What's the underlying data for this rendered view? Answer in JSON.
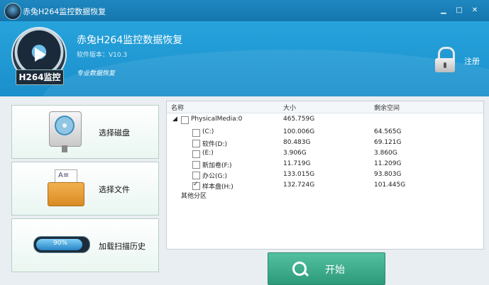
{
  "window": {
    "title": "赤兔H264监控数据恢复"
  },
  "header": {
    "logo_label": "H264监控",
    "app_name": "赤兔H264监控数据恢复",
    "version": "软件版本：V10.3",
    "slogan": "专业数据恢复",
    "register_label": "注册"
  },
  "left_panel": {
    "select_disk": "选择磁盘",
    "select_file": "选择文件",
    "load_history": "加载扫描历史",
    "history_progress_text": "90%",
    "history_progress_fraction": 0.9
  },
  "table": {
    "columns": [
      "名称",
      "大小",
      "剩余空间"
    ],
    "root": {
      "name": "PhysicalMedia:0",
      "size": "465.759G",
      "checked": false
    },
    "rows": [
      {
        "name": "(C:)",
        "size": "100.006G",
        "free": "64.565G",
        "checked": false
      },
      {
        "name": "软件(D:)",
        "size": "80.483G",
        "free": "69.121G",
        "checked": false
      },
      {
        "name": "(E:)",
        "size": "3.906G",
        "free": "3.860G",
        "checked": false
      },
      {
        "name": "新加卷(F:)",
        "size": "11.719G",
        "free": "11.209G",
        "checked": false
      },
      {
        "name": "办公(G:)",
        "size": "133.015G",
        "free": "93.803G",
        "checked": false
      },
      {
        "name": "样本盘(H:)",
        "size": "132.724G",
        "free": "101.445G",
        "checked": true
      }
    ],
    "other": "其他分区"
  },
  "start_button": {
    "label": "开始"
  },
  "colors": {
    "header_blue": "#1a8fcb",
    "start_green": "#3aa888"
  }
}
